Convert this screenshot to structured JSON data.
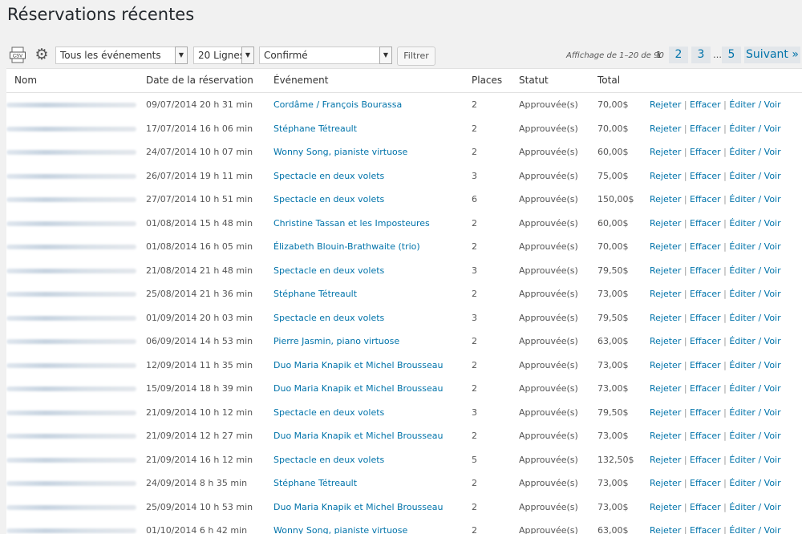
{
  "page": {
    "title": "Réservations récentes"
  },
  "toolbar": {
    "csv_label": "CSV",
    "event_select": "Tous les événements",
    "rows_select": "20 Lignes",
    "status_select": "Confirmé",
    "filter_label": "Filtrer"
  },
  "pagination": {
    "displaying": "Affichage de 1–20 de 90",
    "current": "1",
    "links": [
      "2",
      "3",
      "5"
    ],
    "ellipsis": "…",
    "next": "Suivant »"
  },
  "table": {
    "columns": [
      "Nom",
      "Date de la réservation",
      "Événement",
      "Places",
      "Statut",
      "Total"
    ],
    "actions": {
      "reject": "Rejeter",
      "delete": "Effacer",
      "edit": "Éditer / Voir",
      "sep": " | "
    },
    "rows": [
      {
        "date": "09/07/2014 20 h 31 min",
        "event": "Cordâme / François Bourassa",
        "places": "2",
        "status": "Approuvée(s)",
        "total": "70,00$"
      },
      {
        "date": "17/07/2014 16 h 06 min",
        "event": "Stéphane Tétreault",
        "places": "2",
        "status": "Approuvée(s)",
        "total": "70,00$"
      },
      {
        "date": "24/07/2014 10 h 07 min",
        "event": "Wonny Song, pianiste virtuose",
        "places": "2",
        "status": "Approuvée(s)",
        "total": "60,00$"
      },
      {
        "date": "26/07/2014 19 h 11 min",
        "event": "Spectacle en deux volets",
        "places": "3",
        "status": "Approuvée(s)",
        "total": "75,00$"
      },
      {
        "date": "27/07/2014 10 h 51 min",
        "event": "Spectacle en deux volets",
        "places": "6",
        "status": "Approuvée(s)",
        "total": "150,00$"
      },
      {
        "date": "01/08/2014 15 h 48 min",
        "event": "Christine Tassan et les Imposteures",
        "places": "2",
        "status": "Approuvée(s)",
        "total": "60,00$"
      },
      {
        "date": "01/08/2014 16 h 05 min",
        "event": "Élizabeth Blouin-Brathwaite (trio)",
        "places": "2",
        "status": "Approuvée(s)",
        "total": "70,00$"
      },
      {
        "date": "21/08/2014 21 h 48 min",
        "event": "Spectacle en deux volets",
        "places": "3",
        "status": "Approuvée(s)",
        "total": "79,50$"
      },
      {
        "date": "25/08/2014 21 h 36 min",
        "event": "Stéphane Tétreault",
        "places": "2",
        "status": "Approuvée(s)",
        "total": "73,00$"
      },
      {
        "date": "01/09/2014 20 h 03 min",
        "event": "Spectacle en deux volets",
        "places": "3",
        "status": "Approuvée(s)",
        "total": "79,50$"
      },
      {
        "date": "06/09/2014 14 h 53 min",
        "event": "Pierre Jasmin, piano virtuose",
        "places": "2",
        "status": "Approuvée(s)",
        "total": "63,00$"
      },
      {
        "date": "12/09/2014 11 h 35 min",
        "event": "Duo Maria Knapik et Michel Brousseau",
        "places": "2",
        "status": "Approuvée(s)",
        "total": "73,00$"
      },
      {
        "date": "15/09/2014 18 h 39 min",
        "event": "Duo Maria Knapik et Michel Brousseau",
        "places": "2",
        "status": "Approuvée(s)",
        "total": "73,00$"
      },
      {
        "date": "21/09/2014 10 h 12 min",
        "event": "Spectacle en deux volets",
        "places": "3",
        "status": "Approuvée(s)",
        "total": "79,50$"
      },
      {
        "date": "21/09/2014 12 h 27 min",
        "event": "Duo Maria Knapik et Michel Brousseau",
        "places": "2",
        "status": "Approuvée(s)",
        "total": "73,00$"
      },
      {
        "date": "21/09/2014 16 h 12 min",
        "event": "Spectacle en deux volets",
        "places": "5",
        "status": "Approuvée(s)",
        "total": "132,50$"
      },
      {
        "date": "24/09/2014 8 h 35 min",
        "event": "Stéphane Tétreault",
        "places": "2",
        "status": "Approuvée(s)",
        "total": "73,00$"
      },
      {
        "date": "25/09/2014 10 h 53 min",
        "event": "Duo Maria Knapik et Michel Brousseau",
        "places": "2",
        "status": "Approuvée(s)",
        "total": "73,00$"
      },
      {
        "date": "01/10/2014 6 h 42 min",
        "event": "Wonny Song, pianiste virtuose",
        "places": "2",
        "status": "Approuvée(s)",
        "total": "63,00$"
      }
    ]
  }
}
